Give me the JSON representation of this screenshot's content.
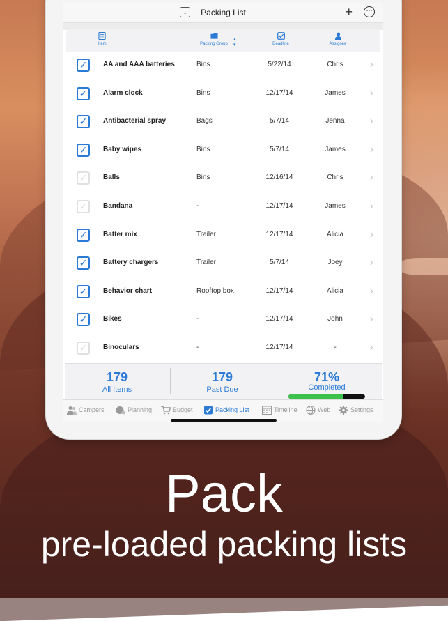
{
  "header": {
    "title": "Packing List"
  },
  "columns": [
    "Item",
    "Packing Group",
    "Deadline",
    "Assignee"
  ],
  "rows": [
    {
      "checked": true,
      "item": "AA and AAA batteries",
      "group": "Bins",
      "deadline": "5/22/14",
      "assignee": "Chris"
    },
    {
      "checked": true,
      "item": "Alarm clock",
      "group": "Bins",
      "deadline": "12/17/14",
      "assignee": "James"
    },
    {
      "checked": true,
      "item": "Antibacterial spray",
      "group": "Bags",
      "deadline": "5/7/14",
      "assignee": "Jenna"
    },
    {
      "checked": true,
      "item": "Baby wipes",
      "group": "Bins",
      "deadline": "5/7/14",
      "assignee": "James"
    },
    {
      "checked": false,
      "item": "Balls",
      "group": "Bins",
      "deadline": "12/16/14",
      "assignee": "Chris"
    },
    {
      "checked": false,
      "item": "Bandana",
      "group": "-",
      "deadline": "12/17/14",
      "assignee": "James"
    },
    {
      "checked": true,
      "item": "Batter mix",
      "group": "Trailer",
      "deadline": "12/17/14",
      "assignee": "Alicia"
    },
    {
      "checked": true,
      "item": "Battery chargers",
      "group": "Trailer",
      "deadline": "5/7/14",
      "assignee": "Joey"
    },
    {
      "checked": true,
      "item": "Behavior chart",
      "group": "Rooftop box",
      "deadline": "12/17/14",
      "assignee": "Alicia"
    },
    {
      "checked": true,
      "item": "Bikes",
      "group": "-",
      "deadline": "12/17/14",
      "assignee": "John"
    },
    {
      "checked": false,
      "item": "Binoculars",
      "group": "-",
      "deadline": "12/17/14",
      "assignee": "-"
    }
  ],
  "stats": {
    "all_count": "179",
    "all_label": "All Items",
    "past_count": "179",
    "past_label": "Past Due",
    "completed_pct": "71%",
    "completed_label": "Completed",
    "completed_fraction": 0.71
  },
  "tabs": [
    {
      "label": "Campers",
      "icon": "people-icon",
      "active": false
    },
    {
      "label": "Planning",
      "icon": "planning-icon",
      "active": false
    },
    {
      "label": "Budget",
      "icon": "cart-icon",
      "active": false
    },
    {
      "label": "Packing List",
      "icon": "checkbox-icon",
      "active": true
    },
    {
      "label": "Timeline",
      "icon": "calendar-icon",
      "active": false
    },
    {
      "label": "Web",
      "icon": "globe-icon",
      "active": false
    },
    {
      "label": "Settings",
      "icon": "gear-icon",
      "active": false
    }
  ],
  "promo": {
    "headline": "Pack",
    "subline": "pre-loaded packing lists"
  },
  "colors": {
    "accent": "#2b7bd6",
    "progress": "#3cc24a"
  }
}
